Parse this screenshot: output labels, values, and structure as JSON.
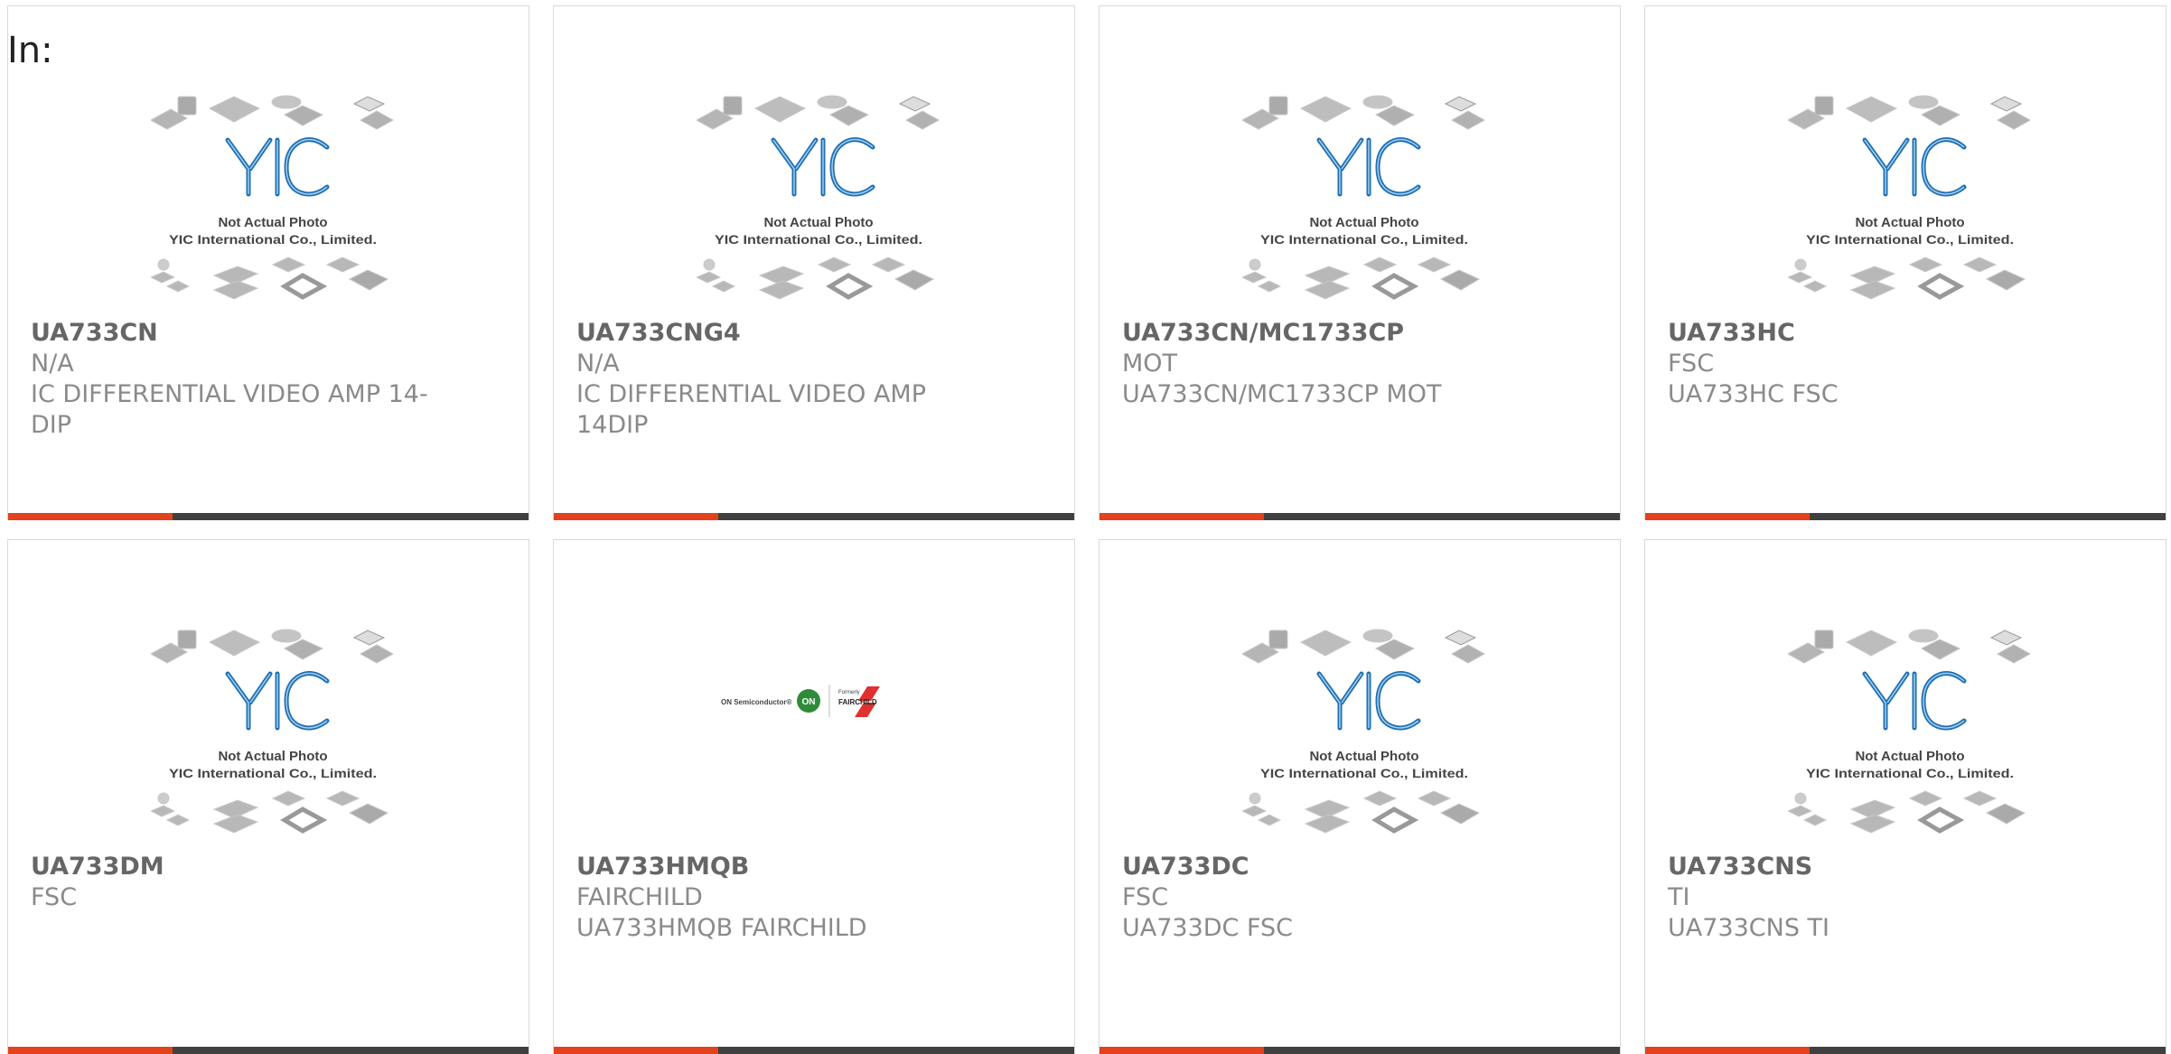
{
  "header": {
    "label": "In:"
  },
  "placeholder": {
    "line1": "Not Actual Photo",
    "line2": "YIC International Co., Limited.",
    "brand": "YIC"
  },
  "colors": {
    "accent": "#e2431c",
    "bar": "#404040",
    "yic_blue": "#1f6fb3"
  },
  "products": [
    {
      "part": "UA733CN",
      "mfr": "N/A",
      "desc": "IC DIFFERENTIAL VIDEO AMP 14-DIP",
      "image": "yic-placeholder"
    },
    {
      "part": "UA733CNG4",
      "mfr": "N/A",
      "desc": "IC DIFFERENTIAL VIDEO AMP 14DIP",
      "image": "yic-placeholder"
    },
    {
      "part": "UA733CN/MC1733CP",
      "mfr": "MOT",
      "desc": "UA733CN/MC1733CP MOT",
      "image": "yic-placeholder"
    },
    {
      "part": "UA733HC",
      "mfr": "FSC",
      "desc": "UA733HC FSC",
      "image": "yic-placeholder"
    },
    {
      "part": "UA733DM",
      "mfr": "FSC",
      "desc": "",
      "image": "yic-placeholder"
    },
    {
      "part": "UA733HMQB",
      "mfr": "FAIRCHILD",
      "desc": "UA733HMQB FAIRCHILD",
      "image": "on-fairchild-logo",
      "logo": {
        "left_text": "ON Semiconductor®",
        "on": "ON",
        "formerly": "Formerly",
        "fairchild": "FAIRCHILD"
      }
    },
    {
      "part": "UA733DC",
      "mfr": "FSC",
      "desc": "UA733DC FSC",
      "image": "yic-placeholder"
    },
    {
      "part": "UA733CNS",
      "mfr": "TI",
      "desc": "UA733CNS TI",
      "image": "yic-placeholder"
    }
  ]
}
